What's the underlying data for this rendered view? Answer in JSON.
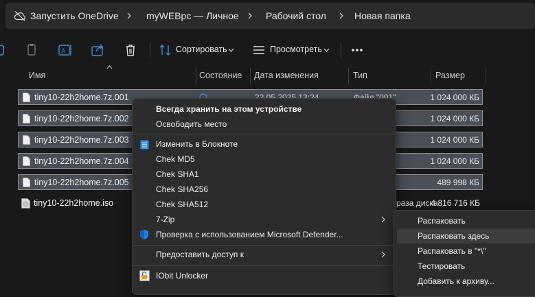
{
  "breadcrumb": [
    "Запустить OneDrive",
    "myWEBpc — Личное",
    "Рабочий стол",
    "Новая папка"
  ],
  "toolbar": {
    "sort_label": "Сортировать",
    "view_label": "Просмотреть"
  },
  "columns": {
    "name": "Имя",
    "status": "Состояние",
    "modified": "Дата изменения",
    "type": "Тип",
    "size": "Размер"
  },
  "files": [
    {
      "name": "tiny10-22h2home.7z.001",
      "size": "1 024 000 КБ",
      "modified": "22.05.2025 13:24",
      "type": "Файл \"001\""
    },
    {
      "name": "tiny10-22h2home.7z.002",
      "size": "1 024 000 КБ"
    },
    {
      "name": "tiny10-22h2home.7z.003",
      "size": "1 024 000 КБ"
    },
    {
      "name": "tiny10-22h2home.7z.004",
      "size": "1 024 000 КБ"
    },
    {
      "name": "tiny10-22h2home.7z.005",
      "size": "489 998 КБ"
    },
    {
      "name": "tiny10-22h2home.iso",
      "size": "4 816 716 КБ",
      "type_fragment": "раза диска"
    }
  ],
  "context_menu": {
    "items": [
      "Всегда хранить на этом устройстве",
      "Освободить место",
      "Изменить в Блокноте",
      "Chek MD5",
      "Chek SHA1",
      "Chek SHA256",
      "Chek SHA512",
      "7-Zip",
      "Проверка с использованием Microsoft Defender...",
      "Предоставить доступ к",
      "IObit Unlocker"
    ]
  },
  "submenu_7zip": {
    "items": [
      "Распаковать",
      "Распаковать здесь",
      "Распаковать в \"*\\\"",
      "Тестировать",
      "Добавить к архиву..."
    ]
  },
  "colors": {
    "background": "#191919",
    "selection": "#4a4f57",
    "menu": "#2c2c2c",
    "defender_blue": "#1f7fe6"
  }
}
